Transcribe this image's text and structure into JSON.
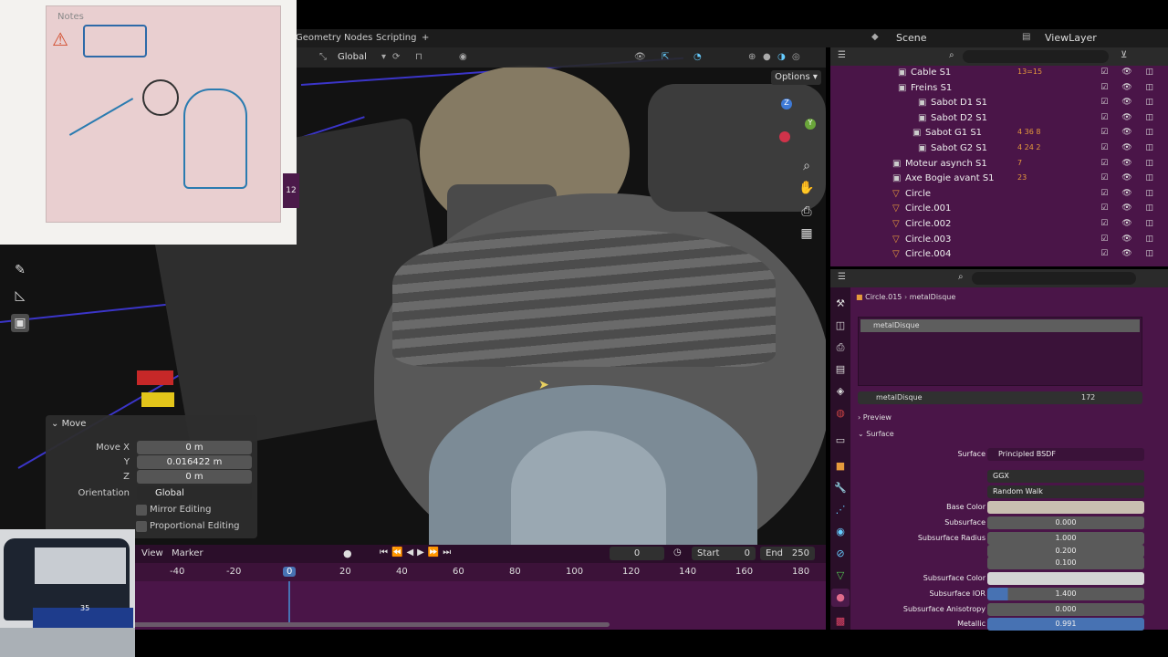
{
  "header": {
    "tabs": [
      "Geometry Nodes",
      "Scripting",
      "+"
    ],
    "scene_label": "Scene",
    "view_layer_label": "ViewLayer"
  },
  "viewport": {
    "orientation": "Global",
    "options_label": "Options"
  },
  "notes_card": {
    "title": "Notes",
    "tab_number": "12"
  },
  "outliner": {
    "items": [
      {
        "label": "Cable S1",
        "suffix": "13=15"
      },
      {
        "label": "Freins S1",
        "suffix": ""
      },
      {
        "label": "Sabot D1 S1",
        "suffix": ""
      },
      {
        "label": "Sabot D2 S1",
        "suffix": ""
      },
      {
        "label": "Sabot G1 S1",
        "suffix": "4 36 8"
      },
      {
        "label": "Sabot G2 S1",
        "suffix": "4 24 2"
      },
      {
        "label": "Moteur asynch S1",
        "suffix": "7"
      },
      {
        "label": "Axe Bogie avant S1",
        "suffix": "23"
      },
      {
        "label": "Circle",
        "suffix": ""
      },
      {
        "label": "Circle.001",
        "suffix": ""
      },
      {
        "label": "Circle.002",
        "suffix": ""
      },
      {
        "label": "Circle.003",
        "suffix": ""
      },
      {
        "label": "Circle.004",
        "suffix": ""
      }
    ]
  },
  "properties": {
    "breadcrumb_object": "Circle.015",
    "breadcrumb_material": "metalDisque",
    "material_slot": "metalDisque",
    "material_name": "metalDisque",
    "user_count": "172",
    "preview_label": "Preview",
    "surface_panel_label": "Surface",
    "rows": [
      {
        "label": "Surface",
        "value": "Principled BSDF"
      },
      {
        "label": "",
        "value": "GGX"
      },
      {
        "label": "",
        "value": "Random Walk"
      },
      {
        "label": "Base Color",
        "value": ""
      },
      {
        "label": "Subsurface",
        "value": "0.000"
      },
      {
        "label": "Subsurface Radius",
        "value": "1.000"
      },
      {
        "label": "",
        "value": "0.200"
      },
      {
        "label": "",
        "value": "0.100"
      },
      {
        "label": "Subsurface Color",
        "value": ""
      },
      {
        "label": "Subsurface IOR",
        "value": "1.400"
      },
      {
        "label": "Subsurface Anisotropy",
        "value": "0.000"
      },
      {
        "label": "Metallic",
        "value": "0.991"
      }
    ],
    "colors": {
      "base_color": "#c8bfb1",
      "accent": "#4772b3"
    }
  },
  "move_panel": {
    "title": "Move",
    "move_x_label": "Move X",
    "move_x": "0 m",
    "y_label": "Y",
    "y": "0.016422 m",
    "z_label": "Z",
    "z": "0 m",
    "orientation_label": "Orientation",
    "orientation": "Global",
    "mirror_editing": "Mirror Editing",
    "proportional_editing": "Proportional Editing"
  },
  "timeline": {
    "view_label": "View",
    "marker_label": "Marker",
    "current_frame": "0",
    "start_label": "Start",
    "start": "0",
    "end_label": "End",
    "end": "250",
    "ticks": [
      "-40",
      "-20",
      "0",
      "20",
      "40",
      "60",
      "80",
      "100",
      "120",
      "140",
      "160",
      "180"
    ]
  },
  "train": {
    "number": "35"
  }
}
